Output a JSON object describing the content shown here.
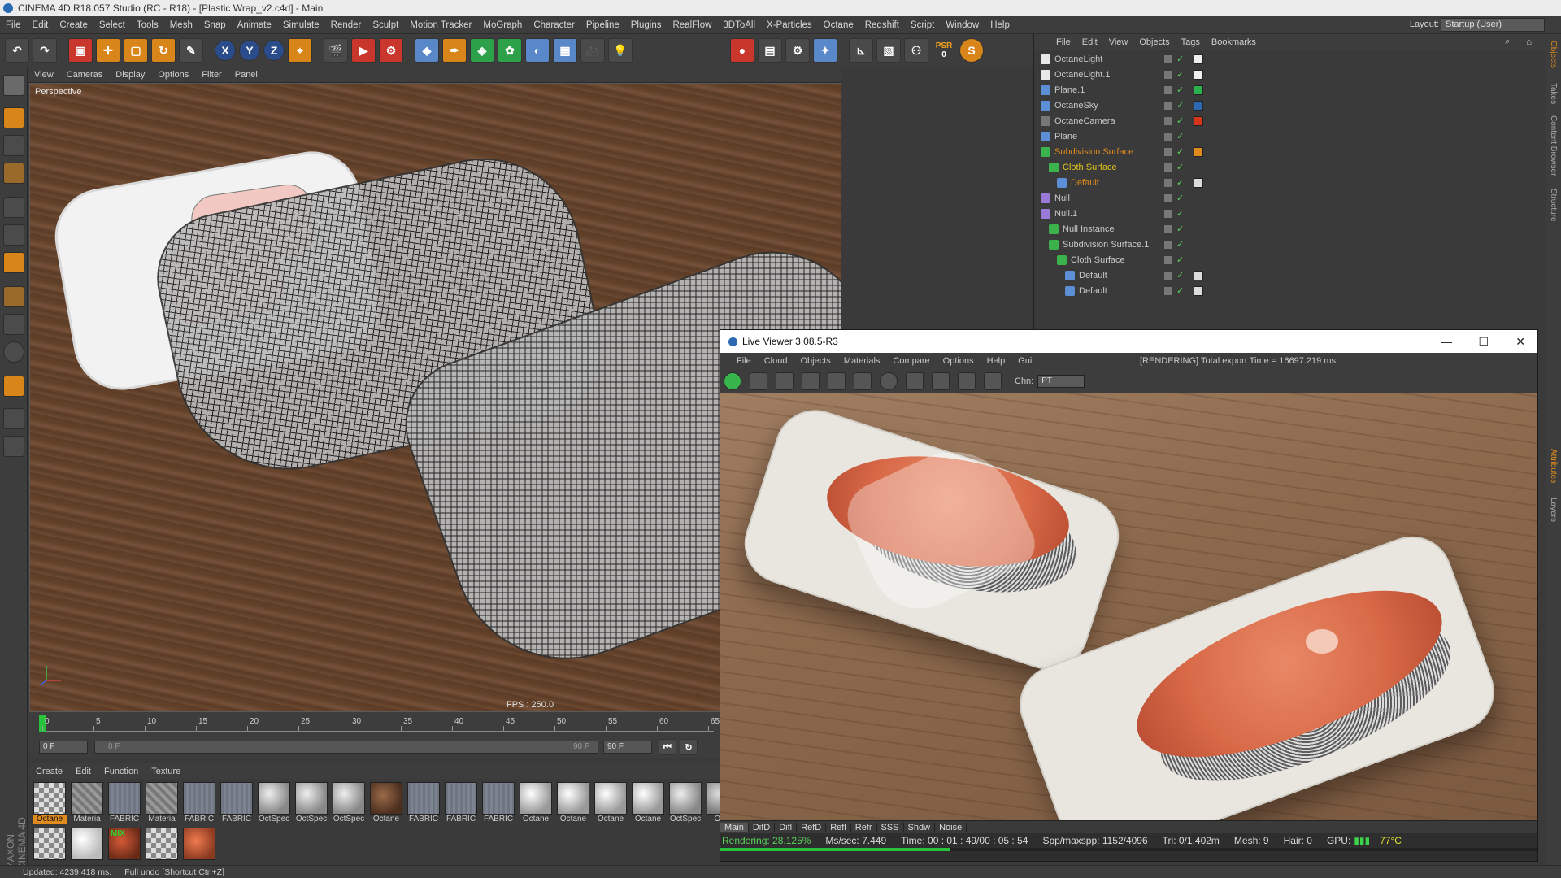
{
  "window": {
    "title": "CINEMA 4D R18.057 Studio (RC - R18) - [Plastic Wrap_v2.c4d] - Main"
  },
  "menubar": {
    "items": [
      "File",
      "Edit",
      "Create",
      "Select",
      "Tools",
      "Mesh",
      "Snap",
      "Animate",
      "Simulate",
      "Render",
      "Sculpt",
      "Motion Tracker",
      "MoGraph",
      "Character",
      "Pipeline",
      "Plugins",
      "RealFlow",
      "3DToAll",
      "X-Particles",
      "Octane",
      "Redshift",
      "Script",
      "Window",
      "Help"
    ],
    "layout_label": "Layout:",
    "layout_value": "Startup (User)"
  },
  "toolbar": {
    "axis_x": "X",
    "axis_y": "Y",
    "axis_z": "Z",
    "psr_label": "PSR",
    "psr_value": "0"
  },
  "viewport": {
    "menu": [
      "View",
      "Cameras",
      "Display",
      "Options",
      "Filter",
      "Panel"
    ],
    "label": "Perspective",
    "fps": "FPS : 250.0"
  },
  "timeline": {
    "ticks": [
      "0",
      "5",
      "10",
      "15",
      "20",
      "25",
      "30",
      "35",
      "40",
      "45",
      "50",
      "55",
      "60",
      "65"
    ],
    "start_field": "0 F",
    "range_start": "0 F",
    "range_end": "90 F",
    "end_field": "90 F"
  },
  "materials": {
    "menu": [
      "Create",
      "Edit",
      "Function",
      "Texture"
    ],
    "row1": [
      "Octane",
      "Materia",
      "FABRIC",
      "Materia",
      "FABRIC",
      "FABRIC",
      "OctSpec",
      "OctSpec",
      "OctSpec",
      "Octane",
      "FABRIC",
      "FABRIC",
      "FABRIC",
      "Octane",
      "Octane",
      "Octane",
      "Octane",
      "OctSpec",
      "Octa"
    ],
    "mix_tag": "MIX"
  },
  "statusbar": {
    "updated": "Updated: 4239.418 ms.",
    "undo": "Full undo [Shortcut Ctrl+Z]"
  },
  "object_manager": {
    "menu": [
      "File",
      "Edit",
      "View",
      "Objects",
      "Tags",
      "Bookmarks"
    ],
    "objects": [
      {
        "name": "OctaneLight",
        "color": "#c8c8c8"
      },
      {
        "name": "OctaneLight.1",
        "color": "#c8c8c8"
      },
      {
        "name": "Plane.1",
        "color": "#c8c8c8"
      },
      {
        "name": "OctaneSky",
        "color": "#c8c8c8"
      },
      {
        "name": "OctaneCamera",
        "color": "#c8c8c8"
      },
      {
        "name": "Plane",
        "color": "#c8c8c8"
      },
      {
        "name": "Subdivision Surface",
        "color": "#e08b1c"
      },
      {
        "name": "Cloth Surface",
        "color": "#e0c21c"
      },
      {
        "name": "Default",
        "color": "#e08b1c"
      },
      {
        "name": "Null",
        "color": "#c8c8c8"
      },
      {
        "name": "Null.1",
        "color": "#c8c8c8"
      },
      {
        "name": "Null Instance",
        "color": "#c8c8c8"
      },
      {
        "name": "Subdivision Surface.1",
        "color": "#c8c8c8"
      },
      {
        "name": "Cloth Surface",
        "color": "#c8c8c8"
      },
      {
        "name": "Default",
        "color": "#c8c8c8"
      },
      {
        "name": "Default",
        "color": "#c8c8c8"
      }
    ]
  },
  "side_tabs": [
    "Objects",
    "Takes",
    "Content Browser",
    "Structure",
    "Attributes",
    "Layers"
  ],
  "live_viewer": {
    "title": "Live Viewer 3.08.5-R3",
    "menu": [
      "File",
      "Cloud",
      "Objects",
      "Materials",
      "Compare",
      "Options",
      "Help",
      "Gui"
    ],
    "message": "[RENDERING] Total export Time = 16697.219 ms",
    "chn_label": "Chn:",
    "chn_value": "PT",
    "tabs": [
      "Main",
      "DifD",
      "Difl",
      "RefD",
      "Refl",
      "Refr",
      "SSS",
      "Shdw",
      "Noise"
    ],
    "status": {
      "rendering": "Rendering: 28.125%",
      "ms_sec": "Ms/sec: 7.449",
      "time": "Time: 00 : 01 : 49/00 : 05 : 54",
      "spp": "Spp/maxspp: 1152/4096",
      "tri": "Tri: 0/1.402m",
      "mesh": "Mesh: 9",
      "hair": "Hair: 0",
      "gpu": "GPU:",
      "temp": "77°C"
    },
    "progress": 0.28125
  }
}
